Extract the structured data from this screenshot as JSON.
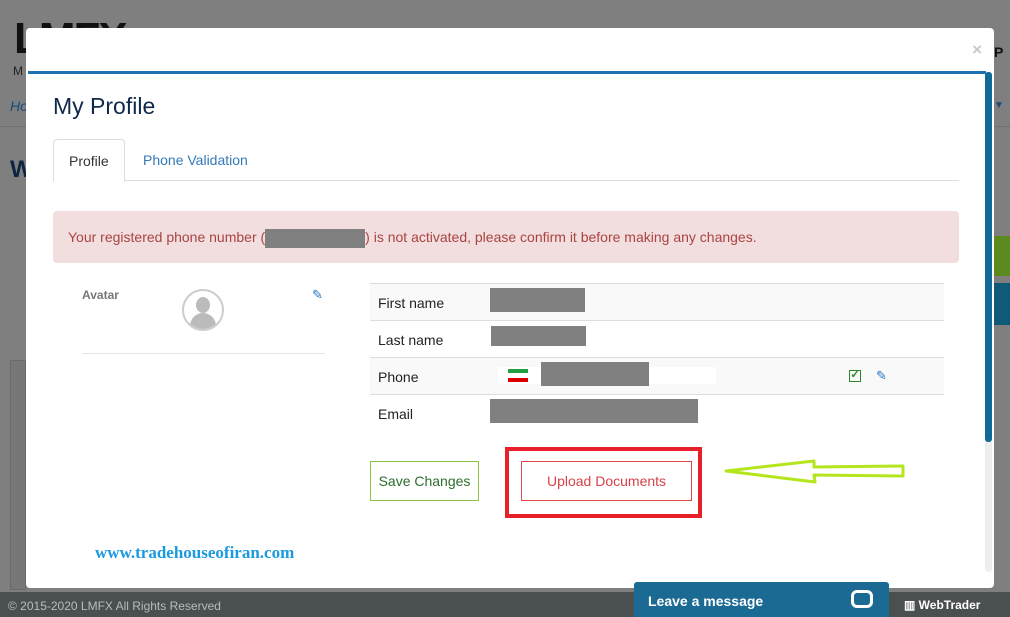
{
  "background": {
    "logo": "LMFX",
    "m": "M",
    "home": "Ho",
    "w": "W",
    "p": "P",
    "copyright": "© 2015-2020 LMFX All Rights Reserved",
    "webtrader": "WebTrader"
  },
  "modal": {
    "close": "×",
    "title": "My Profile",
    "tabs": [
      {
        "label": "Profile",
        "active": true
      },
      {
        "label": "Phone Validation",
        "active": false
      }
    ],
    "alert": {
      "before": "Your registered phone number (",
      "after": ") is not activated, please confirm it before making any changes."
    },
    "avatar_label": "Avatar",
    "fields": [
      {
        "label": "First name"
      },
      {
        "label": "Last name"
      },
      {
        "label": "Phone",
        "verified": true
      },
      {
        "label": "Email"
      }
    ],
    "save_label": "Save Changes",
    "upload_label": "Upload Documents",
    "watermark": "www.tradehouseofiran.com"
  },
  "chat": {
    "label": "Leave a message"
  },
  "colors": {
    "accent": "#1f72b0",
    "alert_bg": "#f2dede",
    "alert_text": "#a94442",
    "highlight": "#e8202a",
    "arrow": "#b5e61d"
  }
}
